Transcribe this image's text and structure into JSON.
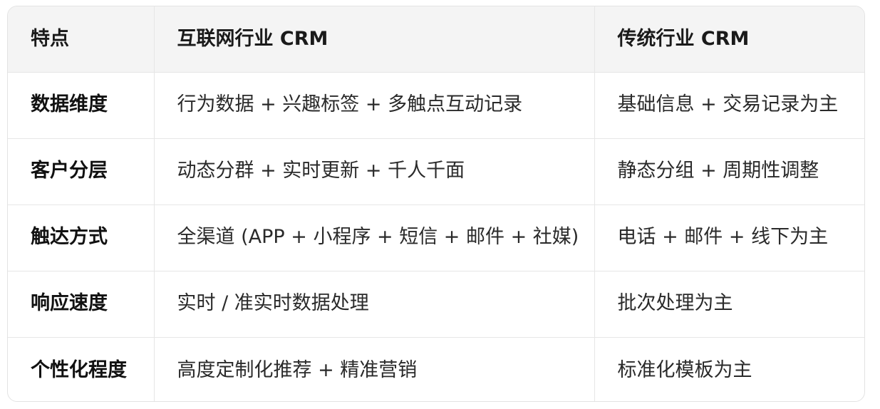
{
  "table": {
    "headers": [
      "特点",
      "互联网行业 CRM",
      "传统行业 CRM"
    ],
    "rows": [
      {
        "feature": "数据维度",
        "internet": "行为数据 + 兴趣标签 + 多触点互动记录",
        "traditional": "基础信息 + 交易记录为主"
      },
      {
        "feature": "客户分层",
        "internet": "动态分群 + 实时更新 + 千人千面",
        "traditional": "静态分组 + 周期性调整"
      },
      {
        "feature": "触达方式",
        "internet": "全渠道 (APP + 小程序 + 短信 + 邮件 + 社媒)",
        "traditional": "电话 + 邮件 + 线下为主"
      },
      {
        "feature": "响应速度",
        "internet": "实时 / 准实时数据处理",
        "traditional": "批次处理为主"
      },
      {
        "feature": "个性化程度",
        "internet": "高度定制化推荐 + 精准营销",
        "traditional": "标准化模板为主"
      }
    ]
  }
}
